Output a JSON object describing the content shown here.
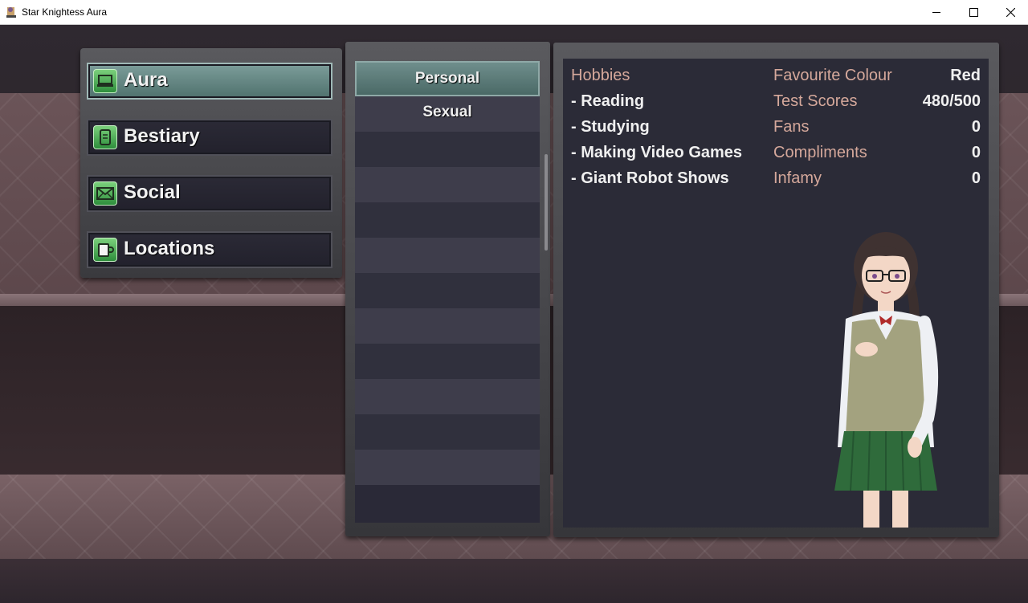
{
  "window": {
    "title": "Star Knightess Aura"
  },
  "menu": {
    "items": [
      {
        "label": "Aura",
        "icon": "laptop-icon",
        "selected": true
      },
      {
        "label": "Bestiary",
        "icon": "scroll-icon",
        "selected": false
      },
      {
        "label": "Social",
        "icon": "envelope-icon",
        "selected": false
      },
      {
        "label": "Locations",
        "icon": "mug-icon",
        "selected": false
      }
    ]
  },
  "categories": {
    "items": [
      {
        "label": "Personal",
        "selected": true
      },
      {
        "label": "Sexual",
        "selected": false
      }
    ]
  },
  "details": {
    "hobbies_title": "Hobbies",
    "hobbies": [
      "- Reading",
      "- Studying",
      "- Making Video Games",
      "- Giant Robot Shows"
    ],
    "stats": [
      {
        "label": "Favourite Colour",
        "value": "Red"
      },
      {
        "label": "Test Scores",
        "value": "480/500"
      },
      {
        "label": "Fans",
        "value": "0"
      },
      {
        "label": "Compliments",
        "value": "0"
      },
      {
        "label": "Infamy",
        "value": "0"
      }
    ]
  },
  "colors": {
    "accent_label": "#d5a89b",
    "selected_teal": "#6f8e8c",
    "icon_green": "#4fb05a"
  }
}
